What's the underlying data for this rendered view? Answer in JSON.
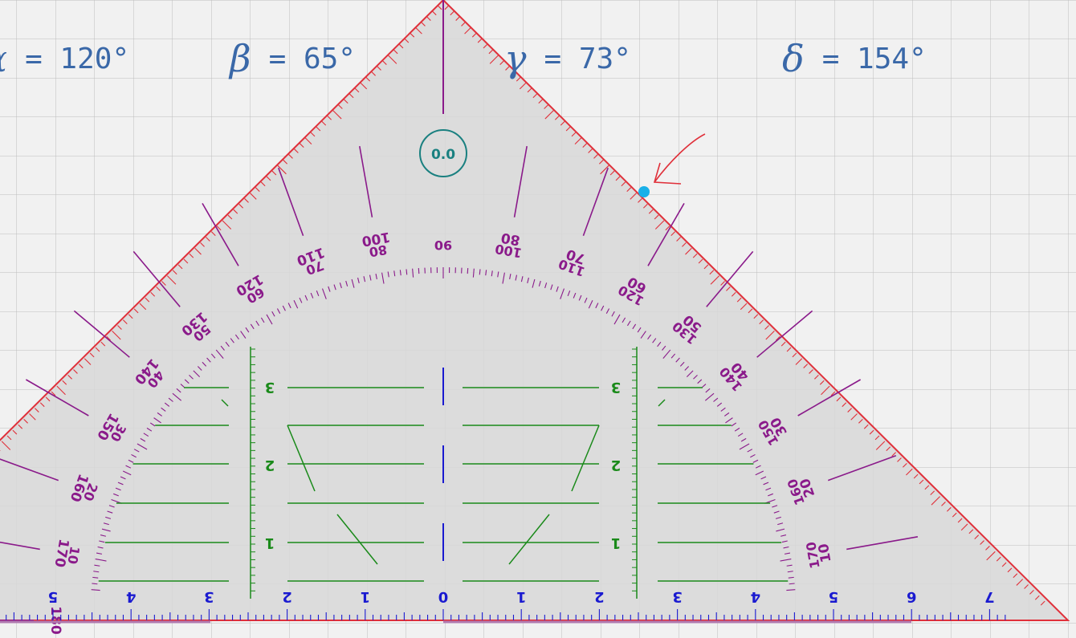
{
  "angles": [
    {
      "symbol": "α",
      "value": "= 120°"
    },
    {
      "symbol": "β",
      "value": "= 65°"
    },
    {
      "symbol": "γ",
      "value": "= 73°"
    },
    {
      "symbol": "δ",
      "value": "= 154°"
    }
  ],
  "triangle": {
    "rotation_readout": "0.0",
    "cm_labels": [
      "5",
      "4",
      "3",
      "2",
      "1",
      "0",
      "1",
      "2",
      "3",
      "4",
      "5",
      "6",
      "7"
    ],
    "vertical_scale_labels": [
      "3",
      "2",
      "1"
    ],
    "outer_scale_labels": [
      "10",
      "20",
      "30",
      "40",
      "50",
      "60",
      "70",
      "80",
      "90",
      "100",
      "110",
      "120",
      "130",
      "140",
      "150",
      "160",
      "170",
      "180"
    ],
    "inner_scale_labels": [
      "10",
      "20",
      "30",
      "40",
      "50",
      "60",
      "70",
      "80",
      "90",
      "100",
      "110",
      "120",
      "130",
      "140",
      "150",
      "160",
      "170"
    ]
  },
  "colors": {
    "grid": "#bdbdbd",
    "triangle_fill": "#d8d8d8",
    "edge": "#e0303a",
    "protractor": "#8a1a8a",
    "cm_ruler": "#1a1ad0",
    "guides": "#1a8a1a",
    "knob": "#1a8080",
    "handle": "#1ab0e8",
    "angle_text": "#3a68a8"
  }
}
